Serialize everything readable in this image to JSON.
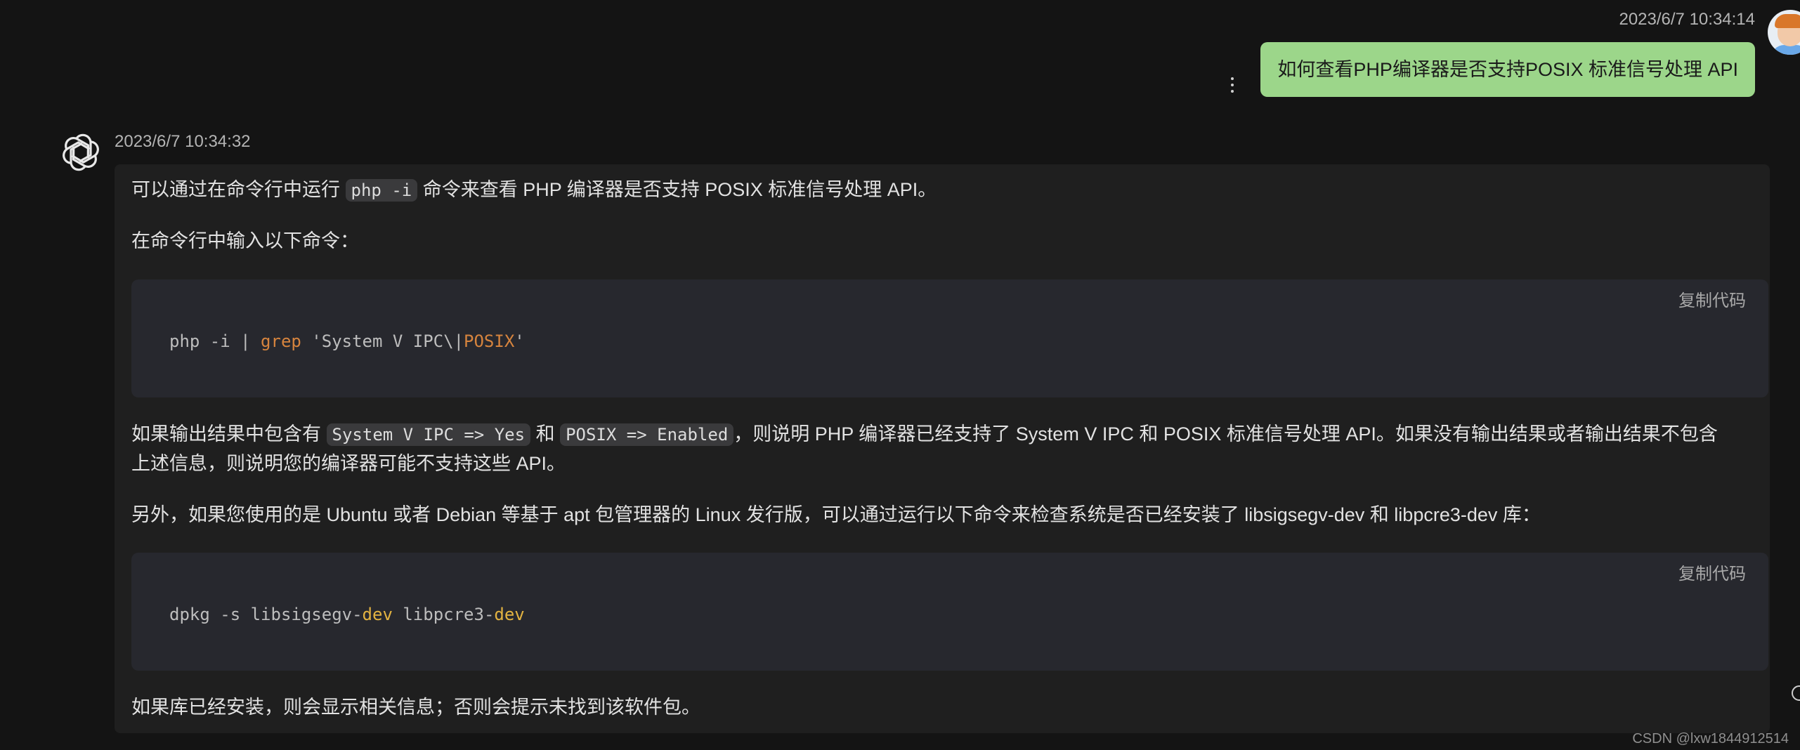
{
  "user_message": {
    "timestamp": "2023/6/7 10:34:14",
    "text": "如何查看PHP编译器是否支持POSIX 标准信号处理 API"
  },
  "bot_message": {
    "timestamp": "2023/6/7 10:34:32",
    "p1_before": "可以通过在命令行中运行 ",
    "p1_code": "php -i",
    "p1_after": " 命令来查看 PHP 编译器是否支持 POSIX 标准信号处理 API。",
    "p2": "在命令行中输入以下命令：",
    "code1": {
      "copy_label": "复制代码",
      "seg1": "php -i | ",
      "seg2": "grep",
      "seg3": " 'System V IPC\\|",
      "seg4": "POSIX",
      "seg5": "'"
    },
    "p3_a": "如果输出结果中包含有 ",
    "p3_code1": "System V IPC => Yes",
    "p3_b": " 和 ",
    "p3_code2": "POSIX => Enabled",
    "p3_c": "，则说明 PHP 编译器已经支持了 System V IPC 和 POSIX 标准信号处理 API。如果没有输出结果或者输出结果不包含",
    "p3_line2": "上述信息，则说明您的编译器可能不支持这些 API。",
    "p4": "另外，如果您使用的是 Ubuntu 或者 Debian 等基于 apt 包管理器的 Linux 发行版，可以通过运行以下命令来检查系统是否已经安装了 libsigsegv-dev 和 libpcre3-dev 库：",
    "code2": {
      "copy_label": "复制代码",
      "seg1": "dpkg -s libsigsegv-",
      "seg2": "dev",
      "seg3": " libpcre3-",
      "seg4": "dev"
    },
    "p5": "如果库已经安装，则会显示相关信息；否则会提示未找到该软件包。"
  },
  "icons": {
    "user_avatar": "avatar",
    "bot_logo": "openai-logo-icon",
    "more_menu": "kebab-menu-icon"
  },
  "watermark": "CSDN @lxw1844912514"
}
